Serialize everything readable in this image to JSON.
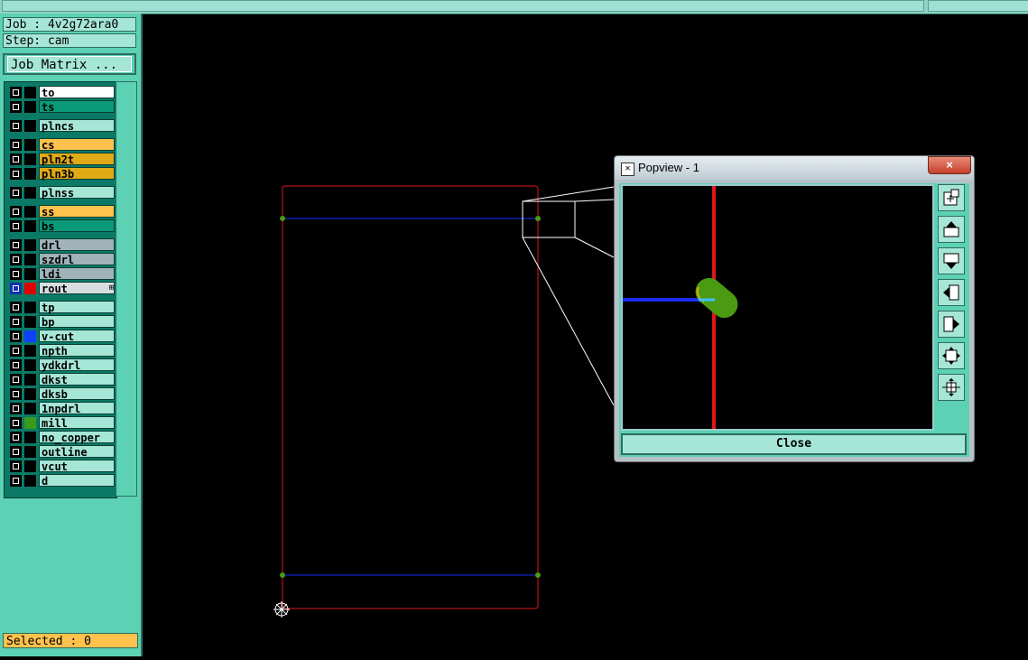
{
  "header": {
    "job_label": "Job : 4v2g72ara0",
    "step_label": "Step: cam"
  },
  "job_matrix_button": "Job Matrix ...",
  "layers": [
    {
      "name": "to",
      "bg": "#ffffff",
      "swatch": "#000000"
    },
    {
      "name": "ts",
      "bg": "#0b9a78",
      "swatch": "#000000"
    },
    {
      "name": "plncs",
      "bg": "#a6e6d6",
      "swatch": "#000000"
    },
    {
      "name": "cs",
      "bg": "#ffc24d",
      "swatch": "#000000"
    },
    {
      "name": "pln2t",
      "bg": "#e0a916",
      "swatch": "#000000"
    },
    {
      "name": "pln3b",
      "bg": "#e0a916",
      "swatch": "#000000"
    },
    {
      "name": "plnss",
      "bg": "#a6e6d6",
      "swatch": "#000000"
    },
    {
      "name": "ss",
      "bg": "#ffc24d",
      "swatch": "#000000"
    },
    {
      "name": "bs",
      "bg": "#0b9a78",
      "swatch": "#000000"
    },
    {
      "name": "drl",
      "bg": "#9fb3b8",
      "swatch": "#000000"
    },
    {
      "name": "szdrl",
      "bg": "#9fb3b8",
      "swatch": "#000000"
    },
    {
      "name": "ldi",
      "bg": "#9fb3b8",
      "swatch": "#000000"
    },
    {
      "name": "rout",
      "bg": "#d8dde0",
      "swatch": "#e00000",
      "cb": "#1030b0",
      "active": true
    },
    {
      "name": "tp",
      "bg": "#a6e6d6",
      "swatch": "#000000"
    },
    {
      "name": "bp",
      "bg": "#a6e6d6",
      "swatch": "#000000"
    },
    {
      "name": "v-cut",
      "bg": "#a6e6d6",
      "swatch": "#1040ff"
    },
    {
      "name": "npth",
      "bg": "#a6e6d6",
      "swatch": "#000000"
    },
    {
      "name": "ydkdrl",
      "bg": "#a6e6d6",
      "swatch": "#000000"
    },
    {
      "name": "dkst",
      "bg": "#a6e6d6",
      "swatch": "#000000"
    },
    {
      "name": "dksb",
      "bg": "#a6e6d6",
      "swatch": "#000000"
    },
    {
      "name": "1npdrl",
      "bg": "#a6e6d6",
      "swatch": "#000000"
    },
    {
      "name": "mill",
      "bg": "#a6e6d6",
      "swatch": "#3a9a1a"
    },
    {
      "name": "no_copper",
      "bg": "#a6e6d6",
      "swatch": "#000000"
    },
    {
      "name": "outline",
      "bg": "#a6e6d6",
      "swatch": "#000000"
    },
    {
      "name": "vcut",
      "bg": "#a6e6d6",
      "swatch": "#000000"
    },
    {
      "name": "d",
      "bg": "#a6e6d6",
      "swatch": "#000000"
    }
  ],
  "status": {
    "selected": "Selected : 0"
  },
  "popview": {
    "title": "Popview - 1",
    "close_x": "×",
    "close_button": "Close",
    "tools": [
      "zoom-window-icon",
      "pan-up-icon",
      "pan-down-icon",
      "pan-left-icon",
      "pan-right-icon",
      "zoom-fit-icon",
      "zoom-home-icon"
    ]
  },
  "colors": {
    "outline_red": "#e01818",
    "vcut_blue": "#1a2dff",
    "mill_green": "#4a9a12",
    "panel_teal": "#5cd1b4"
  }
}
